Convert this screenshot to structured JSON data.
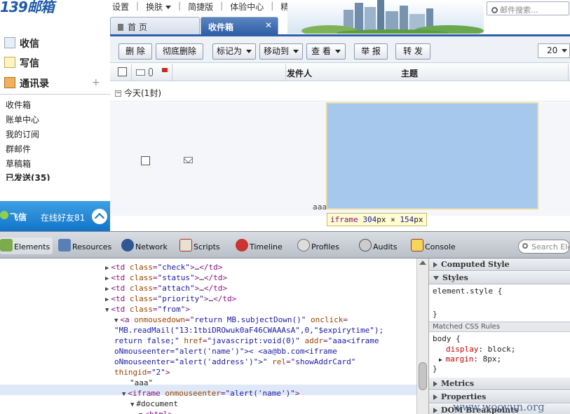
{
  "header": {
    "logo": "139邮箱",
    "nav": [
      "设置",
      "换肤",
      "简捷版",
      "体验中心",
      "精品订阅"
    ],
    "search_placeholder": "邮件搜索..."
  },
  "tabs": {
    "home": "首 页",
    "inbox": "收件箱",
    "close": "✕"
  },
  "toolbar": {
    "delete": "删 除",
    "delete_permanent": "彻底删除",
    "mark_as": "标记为",
    "move_to": "移动到",
    "view": "查 看",
    "report": "举 报",
    "forward": "转 发",
    "page_size": "20"
  },
  "list": {
    "col_from": "发件人",
    "col_subject": "主题",
    "group_label": "今天(1封)",
    "row_text": "aaa"
  },
  "tooltip": {
    "tag": "iframe",
    "w": "304",
    "h": "154",
    "unit": "px",
    "times": "×"
  },
  "leftnav": {
    "receive": "收信",
    "write": "写信",
    "contacts": "通讯录",
    "plus": "+",
    "folders": [
      "收件箱",
      "账单中心",
      "我的订阅",
      "群邮件",
      "草稿箱",
      "已发送(35)"
    ]
  },
  "feixin": {
    "name": "飞信",
    "online": "在线好友81"
  },
  "devtools": {
    "tabs": [
      "Elements",
      "Resources",
      "Network",
      "Scripts",
      "Timeline",
      "Profiles",
      "Audits",
      "Console"
    ],
    "search_placeholder": "Search Ele",
    "dom_lines": [
      {
        "i": 150,
        "t": "▶",
        "h": [
          [
            "tg",
            "<td "
          ],
          [
            "an",
            "class"
          ],
          [
            "tg",
            "="
          ],
          [
            "av",
            "\"check\""
          ],
          [
            "tg",
            ">"
          ],
          [
            "tx",
            "…"
          ],
          [
            "tg",
            "</td>"
          ]
        ]
      },
      {
        "i": 150,
        "t": "▶",
        "h": [
          [
            "tg",
            "<td "
          ],
          [
            "an",
            "class"
          ],
          [
            "tg",
            "="
          ],
          [
            "av",
            "\"status\""
          ],
          [
            "tg",
            ">"
          ],
          [
            "tx",
            "…"
          ],
          [
            "tg",
            "</td>"
          ]
        ]
      },
      {
        "i": 150,
        "t": "▶",
        "h": [
          [
            "tg",
            "<td "
          ],
          [
            "an",
            "class"
          ],
          [
            "tg",
            "="
          ],
          [
            "av",
            "\"attach\""
          ],
          [
            "tg",
            ">"
          ],
          [
            "tx",
            "…"
          ],
          [
            "tg",
            "</td>"
          ]
        ]
      },
      {
        "i": 150,
        "t": "▶",
        "h": [
          [
            "tg",
            "<td "
          ],
          [
            "an",
            "class"
          ],
          [
            "tg",
            "="
          ],
          [
            "av",
            "\"priority\""
          ],
          [
            "tg",
            ">"
          ],
          [
            "tx",
            "…"
          ],
          [
            "tg",
            "</td>"
          ]
        ]
      },
      {
        "i": 150,
        "t": "▼",
        "h": [
          [
            "tg",
            "<td "
          ],
          [
            "an",
            "class"
          ],
          [
            "tg",
            "="
          ],
          [
            "av",
            "\"from\""
          ],
          [
            "tg",
            ">"
          ]
        ]
      },
      {
        "i": 163,
        "t": "▼",
        "h": [
          [
            "tg",
            "<a "
          ],
          [
            "an",
            "onmousedown"
          ],
          [
            "tg",
            "="
          ],
          [
            "av",
            "\"return MB.subjectDown()\""
          ],
          [
            "tg",
            " "
          ],
          [
            "an",
            "onclick"
          ],
          [
            "tg",
            "="
          ]
        ]
      },
      {
        "i": 163,
        "t": "",
        "h": [
          [
            "av",
            "\"MB.readMail(\"13:1tbiDROwuk0aF46CWAAAsA\",0,\"$expirytime\");"
          ]
        ]
      },
      {
        "i": 163,
        "t": "",
        "h": [
          [
            "av",
            "return false;\""
          ],
          [
            "tg",
            " "
          ],
          [
            "an",
            "href"
          ],
          [
            "tg",
            "="
          ],
          [
            "av",
            "\"javascript:void(0)\""
          ],
          [
            "tg",
            " "
          ],
          [
            "an",
            "addr"
          ],
          [
            "tg",
            "="
          ],
          [
            "av",
            "\"aaa<iframe"
          ]
        ]
      },
      {
        "i": 163,
        "t": "",
        "h": [
          [
            "av",
            "oNmouseenter=\"alert('name')\">< <aa@bb.com<iframe"
          ]
        ]
      },
      {
        "i": 163,
        "t": "",
        "h": [
          [
            "av",
            "oNmouseenter=\"alert('address')\">\""
          ],
          [
            "tg",
            " "
          ],
          [
            "an",
            "rel"
          ],
          [
            "tg",
            "="
          ],
          [
            "av",
            "\"showAddrCard\""
          ]
        ]
      },
      {
        "i": 163,
        "t": "",
        "h": [
          [
            "an",
            "thingid"
          ],
          [
            "tg",
            "="
          ],
          [
            "av",
            "\"2\""
          ],
          [
            "tg",
            ">"
          ]
        ]
      },
      {
        "i": 185,
        "t": "",
        "h": [
          [
            "tx",
            "\"aaa\""
          ]
        ]
      },
      {
        "i": 174,
        "t": "▼",
        "h": [
          [
            "tg",
            "<iframe "
          ],
          [
            "an",
            "onmouseenter"
          ],
          [
            "tg",
            "="
          ],
          [
            "av",
            "\"alert('name')\""
          ],
          [
            "tg",
            ">"
          ]
        ]
      },
      {
        "i": 186,
        "t": "▼",
        "h": [
          [
            "tx",
            "#document"
          ]
        ]
      },
      {
        "i": 198,
        "t": "▼",
        "h": [
          [
            "tg",
            "<html>"
          ]
        ]
      }
    ],
    "side": {
      "computed": "Computed Style",
      "styles": "Styles",
      "element_style": "element.style {",
      "close_brace": "}",
      "matched": "Matched CSS Rules",
      "body_open": "body {",
      "prop1_name": "display",
      "prop1_val": "block",
      "prop2_name": "margin",
      "prop2_val": "8px",
      "metrics": "Metrics",
      "properties": "Properties",
      "dom_breakpoints": "DOM Breakpoints"
    }
  },
  "watermark": "www.wooyun.org",
  "colors": {
    "accent": "#2f5fa6",
    "iframe_fill": "#a6c8ec",
    "feixin": "#1274c8"
  }
}
